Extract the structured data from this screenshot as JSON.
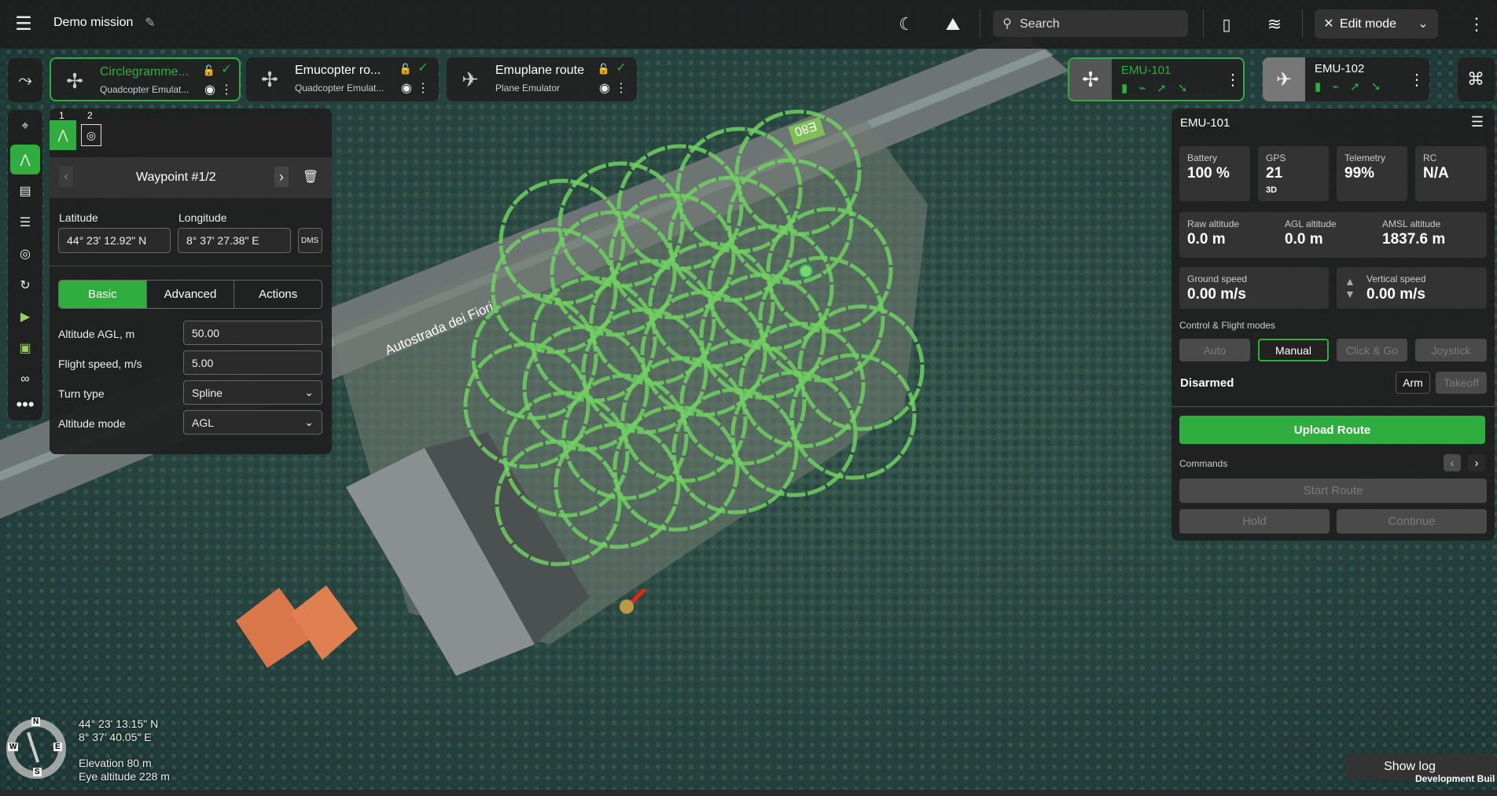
{
  "topbar": {
    "title": "Demo mission",
    "search_placeholder": "Search",
    "mode": "Edit mode"
  },
  "routes": [
    {
      "name": "Circlegramme...",
      "vehicle": "Quadcopter Emulat...",
      "active": true
    },
    {
      "name": "Emucopter ro...",
      "vehicle": "Quadcopter Emulat...",
      "active": false
    },
    {
      "name": "Emuplane route",
      "vehicle": "Plane Emulator",
      "active": false
    }
  ],
  "waypoint_panel": {
    "tabs": [
      "1",
      "2"
    ],
    "title": "Waypoint #1/2",
    "latitude_label": "Latitude",
    "longitude_label": "Longitude",
    "latitude": "44° 23' 12.92\" N",
    "longitude": "8° 37' 27.38\" E",
    "format": "DMS",
    "segments": [
      "Basic",
      "Advanced",
      "Actions"
    ],
    "fields": [
      {
        "label": "Altitude AGL, m",
        "value": "50.00"
      },
      {
        "label": "Flight speed, m/s",
        "value": "5.00"
      },
      {
        "label": "Turn type",
        "value": "Spline"
      },
      {
        "label": "Altitude mode",
        "value": "AGL"
      }
    ]
  },
  "vehicles": [
    {
      "name": "EMU-101",
      "active": true
    },
    {
      "name": "EMU-102",
      "active": false
    }
  ],
  "vehicle_panel": {
    "title": "EMU-101",
    "battery": {
      "label": "Battery",
      "value": "100 %"
    },
    "gps": {
      "label": "GPS",
      "value": "21",
      "fix": "3D"
    },
    "telemetry": {
      "label": "Telemetry",
      "value": "99%"
    },
    "rc": {
      "label": "RC",
      "value": "N/A"
    },
    "raw_alt": {
      "label": "Raw altitude",
      "value": "0.0 m"
    },
    "agl_alt": {
      "label": "AGL altitude",
      "value": "0.0 m"
    },
    "amsl_alt": {
      "label": "AMSL altitude",
      "value": "1837.6 m"
    },
    "ground_speed": {
      "label": "Ground speed",
      "value": "0.00 m/s"
    },
    "vertical_speed": {
      "label": "Vertical speed",
      "value": "0.00 m/s"
    },
    "modes_label": "Control & Flight modes",
    "modes": [
      "Auto",
      "Manual",
      "Click & Go",
      "Joystick"
    ],
    "state": "Disarmed",
    "arm": "Arm",
    "takeoff": "Takeoff",
    "upload": "Upload Route",
    "commands_label": "Commands",
    "start_route": "Start Route",
    "hold": "Hold",
    "continue": "Continue",
    "accent": "#2fae3f"
  },
  "map": {
    "road_label": "Autostrada dei Fiori",
    "sign": "E80",
    "lat": "44° 23' 13.15\" N",
    "lon": "8° 37' 40.05\" E",
    "elevation": "Elevation 80 m",
    "eye": "Eye altitude 228 m",
    "compass": [
      "N",
      "E",
      "S",
      "W"
    ]
  },
  "footer": {
    "show_log": "Show log",
    "build": "Development Buil"
  }
}
